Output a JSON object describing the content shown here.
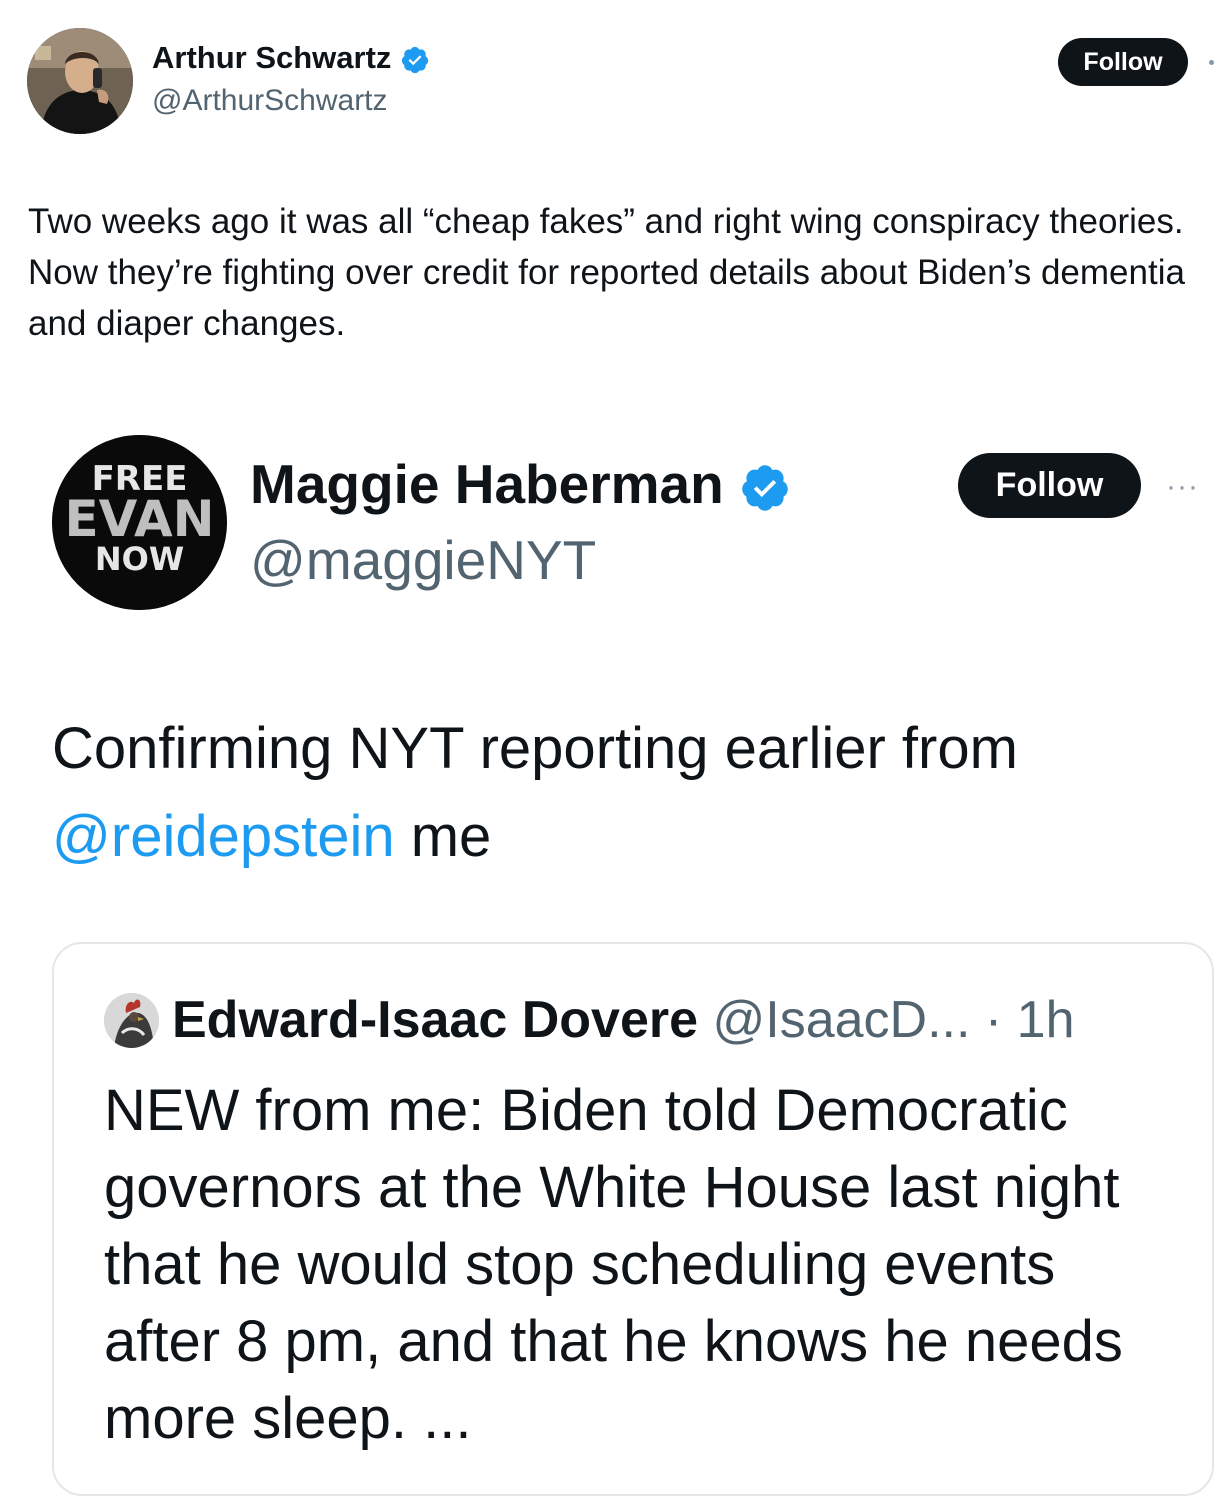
{
  "outer_tweet": {
    "author_name": "Arthur Schwartz",
    "handle": "@ArthurSchwartz",
    "follow_label": "Follow",
    "text": "Two weeks ago it was all “cheap fakes” and right wing conspiracy theories. Now they’re fighting over credit for reported details about Biden’s dementia and diaper changes."
  },
  "embedded_tweet": {
    "avatar_text": {
      "line1": "FREE",
      "line2": "EVAN",
      "line3": "NOW"
    },
    "author_name": "Maggie Haberman",
    "handle": "@maggieNYT",
    "follow_label": "Follow",
    "more_label": "···",
    "text_before": "Confirming NYT reporting earlier from ",
    "mention": "@reidepstein",
    "text_after": " me"
  },
  "quoted_tweet": {
    "author_name": "Edward-Isaac Dovere",
    "handle_time": " @IsaacD... · 1h",
    "text": "NEW from me: Biden told Democratic governors at the White House last night that he would stop scheduling events after 8 pm, and that he knows he needs more sleep. ..."
  },
  "colors": {
    "text": "#0f1419",
    "secondary": "#536471",
    "link": "#1d9bf0",
    "verified": "#1d9bf0",
    "button_bg": "#0f1419"
  },
  "icons": {
    "verified": "verified-badge-icon",
    "more": "more-dots-icon"
  }
}
